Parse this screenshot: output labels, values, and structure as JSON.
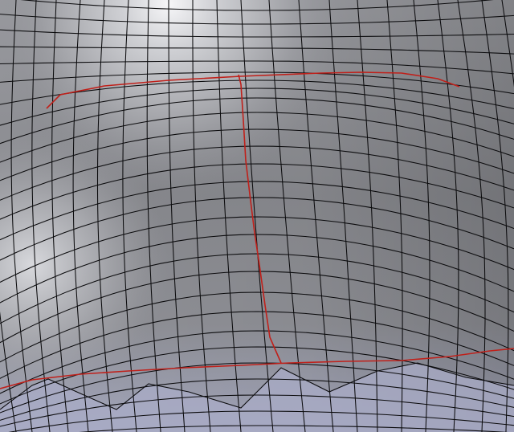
{
  "viewport": {
    "mesh_surface_color": "#8e8f94",
    "highlight_color": "#f4f4f6",
    "shadow_color": "#6f7176",
    "lower_tint_color": "#a7aac4",
    "wire_color": "#0b0b0d",
    "seam_color": "#c0201a"
  }
}
